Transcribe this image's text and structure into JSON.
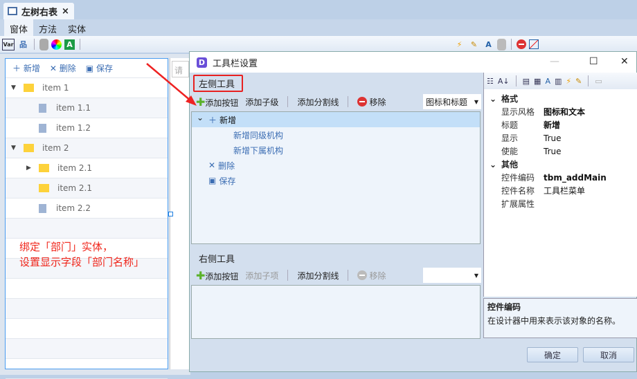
{
  "doc_tab": {
    "title": "左树右表",
    "close": "×"
  },
  "menu": [
    "窗体",
    "方法",
    "实体"
  ],
  "toolbar_left_icons": [
    "var-icon",
    "org-chart-icon",
    "database-icon",
    "color-wheel-icon",
    "text-a-icon"
  ],
  "toolbar_right_icons": [
    "lightning-icon",
    "edit-icon",
    "font-icon",
    "database-icon",
    "stop-icon",
    "diagonal-icon"
  ],
  "tree_panel": {
    "toolbar": {
      "add": "新增",
      "delete": "删除",
      "save": "保存"
    },
    "rows": [
      {
        "label": "item 1",
        "type": "folder-open",
        "level": 0,
        "expand": "down"
      },
      {
        "label": "item 1.1",
        "type": "doc",
        "level": 1
      },
      {
        "label": "item 1.2",
        "type": "doc",
        "level": 1
      },
      {
        "label": "item 2",
        "type": "folder-open",
        "level": 0,
        "expand": "down"
      },
      {
        "label": "item 2.1",
        "type": "folder",
        "level": 1,
        "expand": "right"
      },
      {
        "label": "item 2.1",
        "type": "folder",
        "level": 1
      },
      {
        "label": "item 2.2",
        "type": "doc",
        "level": 1
      }
    ],
    "grid_placeholder": "请输"
  },
  "annotation": {
    "line1": "绑定「部门」实体，",
    "line2": "设置显示字段「部门名称」",
    "color": "#f0261b"
  },
  "dialog": {
    "title": "工具栏设置",
    "left": {
      "label": "左侧工具",
      "toolbar": {
        "add_button": "添加按钮",
        "add_child": "添加子级",
        "add_separator": "添加分割线",
        "remove": "移除",
        "style": "图标和标题"
      },
      "items": [
        {
          "label": "新增",
          "icon": "plus-icon",
          "level": 0,
          "selected": true
        },
        {
          "label": "新增同级机构",
          "level": 1
        },
        {
          "label": "新增下属机构",
          "level": 1
        },
        {
          "label": "删除",
          "icon": "close-icon",
          "level": 0
        },
        {
          "label": "保存",
          "icon": "save-icon",
          "level": 0
        }
      ]
    },
    "right": {
      "label": "右侧工具",
      "toolbar": {
        "add_button": "添加按钮",
        "add_child": "添加子项",
        "add_separator": "添加分割线",
        "remove": "移除",
        "style": ""
      }
    },
    "properties": {
      "cat1": "格式",
      "rows1": [
        {
          "k": "显示风格",
          "v": "图标和文本",
          "bold": true
        },
        {
          "k": "标题",
          "v": "新增",
          "bold": true
        },
        {
          "k": "显示",
          "v": "True"
        },
        {
          "k": "使能",
          "v": "True"
        }
      ],
      "cat2": "其他",
      "rows2": [
        {
          "k": "控件编码",
          "v": "tbm_addMain",
          "bold": true
        },
        {
          "k": "控件名称",
          "v": "工具栏菜单"
        },
        {
          "k": "扩展属性",
          "v": ""
        }
      ],
      "desc_title": "控件编码",
      "desc_text": "在设计器中用来表示该对象的名称。"
    },
    "ok": "确定",
    "cancel": "取消"
  }
}
